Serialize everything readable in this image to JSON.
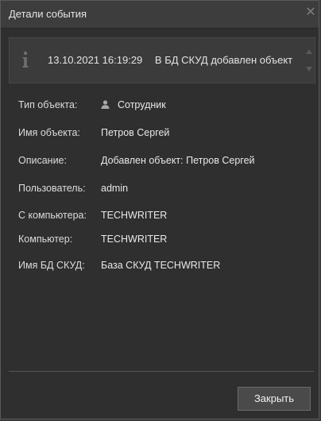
{
  "window": {
    "title": "Детали события"
  },
  "header": {
    "timestamp": "13.10.2021 16:19:29",
    "message": "В БД СКУД добавлен объект",
    "icon": "info-icon"
  },
  "details": {
    "object_type": {
      "label": "Тип объекта:",
      "value": "Сотрудник",
      "icon": "user-icon"
    },
    "object_name": {
      "label": "Имя объекта:",
      "value": "Петров Сергей"
    },
    "description": {
      "label": "Описание:",
      "value": "Добавлен объект: Петров Сергей"
    },
    "user": {
      "label": "Пользователь:",
      "value": "admin"
    },
    "from_computer": {
      "label": "С компьютера:",
      "value": "TECHWRITER"
    },
    "computer": {
      "label": "Компьютер:",
      "value": "TECHWRITER"
    },
    "db_name": {
      "label": "Имя БД СКУД:",
      "value": "База СКУД TECHWRITER"
    }
  },
  "footer": {
    "close_label": "Закрыть"
  },
  "colors": {
    "background": "#2f2f2f",
    "titlebar": "#3d3d3d",
    "panel": "#3b3b3b",
    "text": "#e4e4e4",
    "button": "#4a4a4a"
  }
}
